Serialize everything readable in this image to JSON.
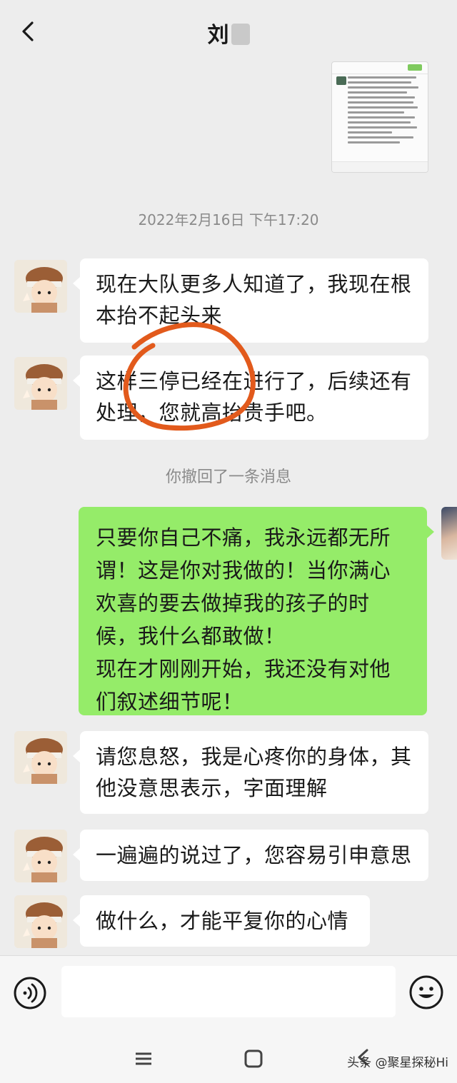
{
  "header": {
    "title": "刘",
    "back_icon": "chevron-left-icon"
  },
  "chat": {
    "timestamp": "2022年2月16日 下午17:20",
    "recall_notice": "你撤回了一条消息",
    "messages": [
      {
        "side": "left",
        "text": "现在大队更多人知道了，我现在根本抬不起头来"
      },
      {
        "side": "left",
        "text": "这样三停已经在进行了，后续还有处理，您就高抬贵手吧。"
      },
      {
        "side": "right",
        "text": "只要你自己不痛，我永远都无所谓！这是你对我做的！当你满心欢喜的要去做掉我的孩子的时候，我什么都敢做！\n现在才刚刚开始，我还没有对他们叙述细节呢！"
      },
      {
        "side": "left",
        "text": "请您息怒，我是心疼你的身体，其他没意思表示，字面理解"
      },
      {
        "side": "left",
        "text": "一遍遍的说过了，您容易引申意思"
      },
      {
        "side": "left",
        "text": "做什么，才能平复你的心情"
      }
    ]
  },
  "input_bar": {
    "text_value": "",
    "voice_icon": "voice-icon",
    "emoji_icon": "emoji-icon"
  },
  "nav": {
    "menu_icon": "menu-icon",
    "home_icon": "home-icon",
    "back_icon": "back-icon"
  },
  "watermark": "头条 @聚星探秘Hi",
  "colors": {
    "background": "#ededed",
    "sent_bubble": "#95ec69",
    "received_bubble": "#ffffff",
    "annotation": "#e25a1c"
  }
}
